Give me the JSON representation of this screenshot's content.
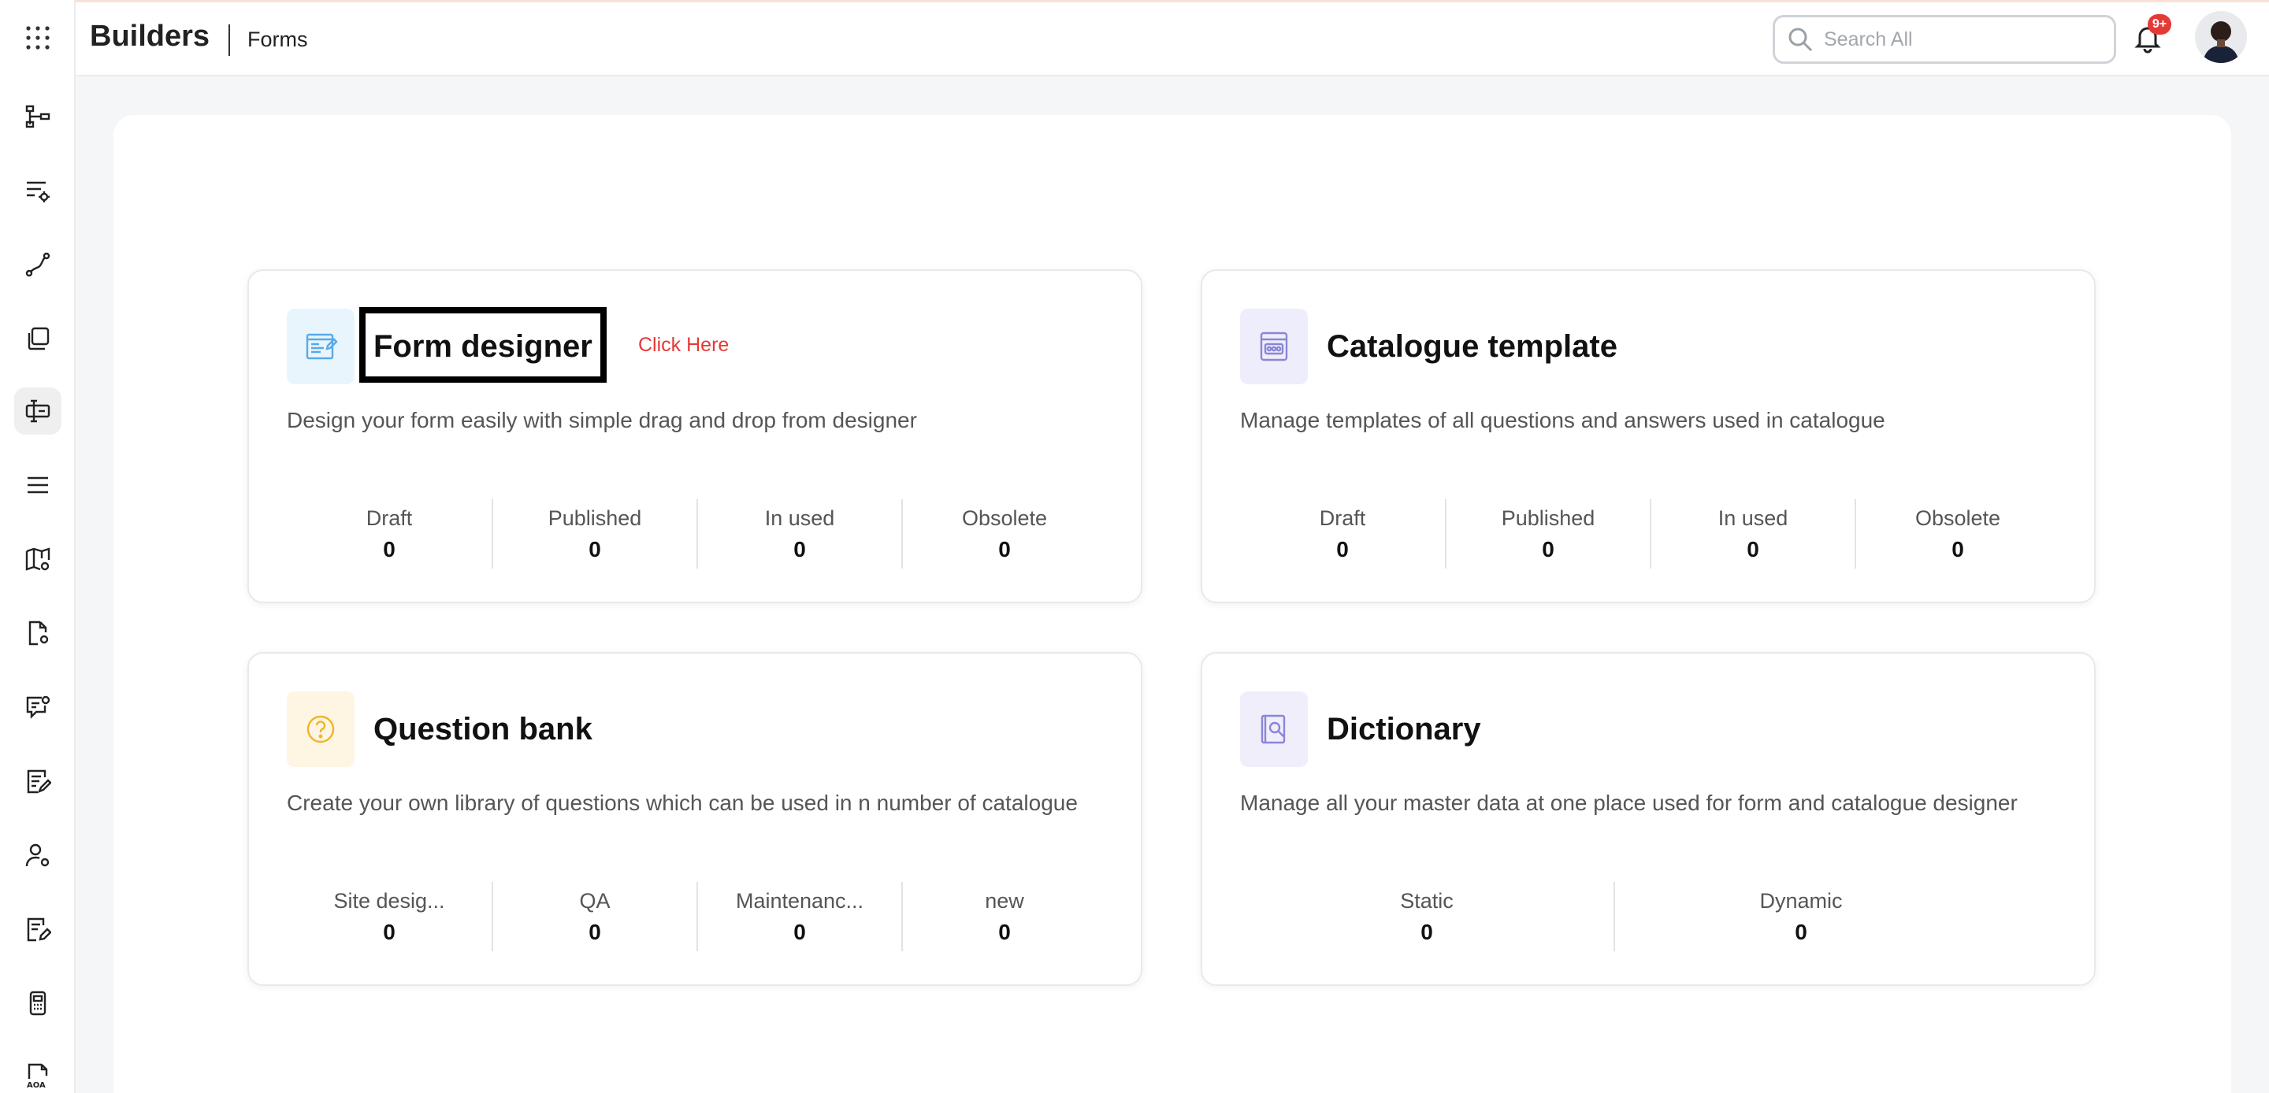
{
  "app": {
    "brand": "Builders",
    "section": "Forms"
  },
  "header": {
    "search_placeholder": "Search All",
    "notification_badge": "9+"
  },
  "sidebar": {
    "items": [
      {
        "icon": "grid-menu-icon",
        "active": false
      },
      {
        "icon": "hierarchy-icon",
        "active": false
      },
      {
        "icon": "list-settings-icon",
        "active": false
      },
      {
        "icon": "workflow-icon",
        "active": false
      },
      {
        "icon": "copy-icon",
        "active": false
      },
      {
        "icon": "form-builder-icon",
        "active": true
      },
      {
        "icon": "menu-lines-icon",
        "active": false
      },
      {
        "icon": "map-settings-icon",
        "active": false
      },
      {
        "icon": "document-settings-icon",
        "active": false
      },
      {
        "icon": "chat-settings-icon",
        "active": false
      },
      {
        "icon": "edit-document-icon",
        "active": false
      },
      {
        "icon": "user-settings-icon",
        "active": false
      },
      {
        "icon": "document-edit-icon",
        "active": false
      },
      {
        "icon": "device-icon",
        "active": false
      },
      {
        "icon": "aoa-document-icon",
        "active": false
      }
    ]
  },
  "cards": [
    {
      "title": "Form designer",
      "description": "Design your form easily with simple drag and drop from designer",
      "link": "Click Here",
      "icon": "form-designer-icon",
      "icon_bg": "#e8f5fd",
      "icon_color": "#5aa9e6",
      "stats": [
        {
          "label": "Draft",
          "value": "0"
        },
        {
          "label": "Published",
          "value": "0"
        },
        {
          "label": "In used",
          "value": "0"
        },
        {
          "label": "Obsolete",
          "value": "0"
        }
      ]
    },
    {
      "title": "Catalogue template",
      "description": "Manage templates of all questions and answers used in catalogue",
      "icon": "catalogue-template-icon",
      "icon_bg": "#eeedfb",
      "icon_color": "#8a86d6",
      "stats": [
        {
          "label": "Draft",
          "value": "0"
        },
        {
          "label": "Published",
          "value": "0"
        },
        {
          "label": "In used",
          "value": "0"
        },
        {
          "label": "Obsolete",
          "value": "0"
        }
      ]
    },
    {
      "title": "Question bank",
      "description": "Create your own library of questions which can be used in n number of catalogue",
      "icon": "question-icon",
      "icon_bg": "#fef5e2",
      "icon_color": "#f0b429",
      "stats": [
        {
          "label": "Site desig...",
          "value": "0"
        },
        {
          "label": "QA",
          "value": "0"
        },
        {
          "label": "Maintenanc...",
          "value": "0"
        },
        {
          "label": "new",
          "value": "0"
        }
      ]
    },
    {
      "title": "Dictionary",
      "description": "Manage all your master data at one place used for form and catalogue designer",
      "icon": "dictionary-icon",
      "icon_bg": "#f0eefb",
      "icon_color": "#8a86d6",
      "stats": [
        {
          "label": "Static",
          "value": "0"
        },
        {
          "label": "Dynamic",
          "value": "0"
        }
      ]
    }
  ]
}
